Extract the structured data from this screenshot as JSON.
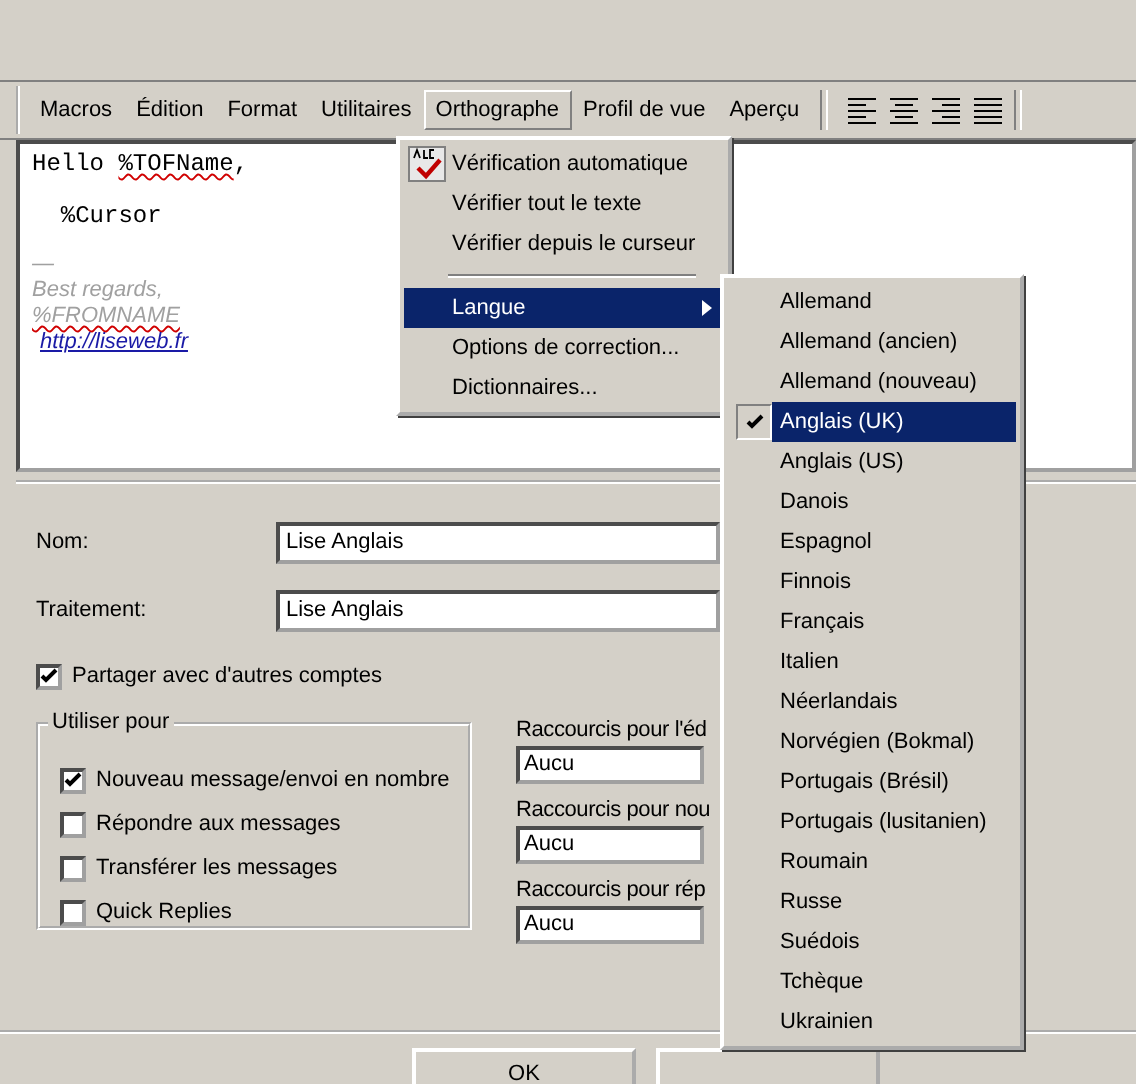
{
  "menubar": {
    "items": [
      {
        "label": "Macros",
        "selected": false
      },
      {
        "label": "Édition",
        "selected": false
      },
      {
        "label": "Format",
        "selected": false
      },
      {
        "label": "Utilitaires",
        "selected": false
      },
      {
        "label": "Orthographe",
        "selected": true
      },
      {
        "label": "Profil de vue",
        "selected": false
      },
      {
        "label": "Aperçu",
        "selected": false
      }
    ]
  },
  "editor": {
    "lines": [
      {
        "kind": "code",
        "segments": [
          {
            "text": "Hello ",
            "misspelled": false
          },
          {
            "text": "%TOFName",
            "misspelled": true
          },
          {
            "text": ",",
            "misspelled": false
          }
        ]
      },
      {
        "kind": "blank"
      },
      {
        "kind": "code",
        "segments": [
          {
            "text": "  %Cursor",
            "misspelled": false
          }
        ]
      },
      {
        "kind": "blank"
      },
      {
        "kind": "signature",
        "segments": [
          {
            "text": "—",
            "misspelled": false
          }
        ]
      },
      {
        "kind": "signature",
        "segments": [
          {
            "text": "Best regards,",
            "misspelled": false
          }
        ]
      },
      {
        "kind": "signature",
        "segments": [
          {
            "text": "%FROMNAME",
            "misspelled": true
          }
        ]
      },
      {
        "kind": "link",
        "segments": [
          {
            "text": "http://liseweb.fr",
            "misspelled": false
          }
        ]
      }
    ]
  },
  "spell_menu": {
    "items": [
      {
        "kind": "toggle",
        "label": "Vérification automatique",
        "checked": true,
        "selected": false
      },
      {
        "kind": "item",
        "label": "Vérifier tout le texte",
        "selected": false
      },
      {
        "kind": "item",
        "label": "Vérifier depuis le curseur",
        "selected": false
      },
      {
        "kind": "separator"
      },
      {
        "kind": "submenu",
        "label": "Langue",
        "selected": true
      },
      {
        "kind": "item",
        "label": "Options de correction...",
        "selected": false
      },
      {
        "kind": "item",
        "label": "Dictionnaires...",
        "selected": false
      }
    ]
  },
  "language_menu": {
    "items": [
      {
        "label": "Allemand",
        "checked": false,
        "selected": false
      },
      {
        "label": "Allemand (ancien)",
        "checked": false,
        "selected": false
      },
      {
        "label": "Allemand (nouveau)",
        "checked": false,
        "selected": false
      },
      {
        "label": "Anglais (UK)",
        "checked": true,
        "selected": true
      },
      {
        "label": "Anglais (US)",
        "checked": false,
        "selected": false
      },
      {
        "label": "Danois",
        "checked": false,
        "selected": false
      },
      {
        "label": "Espagnol",
        "checked": false,
        "selected": false
      },
      {
        "label": "Finnois",
        "checked": false,
        "selected": false
      },
      {
        "label": "Français",
        "checked": false,
        "selected": false
      },
      {
        "label": "Italien",
        "checked": false,
        "selected": false
      },
      {
        "label": "Néerlandais",
        "checked": false,
        "selected": false
      },
      {
        "label": "Norvégien (Bokmal)",
        "checked": false,
        "selected": false
      },
      {
        "label": "Portugais (Brésil)",
        "checked": false,
        "selected": false
      },
      {
        "label": "Portugais (lusitanien)",
        "checked": false,
        "selected": false
      },
      {
        "label": "Roumain",
        "checked": false,
        "selected": false
      },
      {
        "label": "Russe",
        "checked": false,
        "selected": false
      },
      {
        "label": "Suédois",
        "checked": false,
        "selected": false
      },
      {
        "label": "Tchèque",
        "checked": false,
        "selected": false
      },
      {
        "label": "Ukrainien",
        "checked": false,
        "selected": false
      }
    ]
  },
  "form": {
    "fields": [
      {
        "label": "Nom:",
        "value": "Lise Anglais"
      },
      {
        "label": "Traitement:",
        "value": "Lise Anglais"
      }
    ],
    "share": {
      "label": "Partager avec d'autres comptes",
      "checked": true
    },
    "use_for": {
      "title": "Utiliser pour",
      "options": [
        {
          "label": "Nouveau message/envoi en nombre",
          "checked": true
        },
        {
          "label": "Répondre aux messages",
          "checked": false
        },
        {
          "label": "Transférer les messages",
          "checked": false
        },
        {
          "label": "Quick Replies",
          "checked": false
        }
      ]
    },
    "shortcuts": [
      {
        "label": "Raccourcis pour l'éd",
        "value": "Aucu"
      },
      {
        "label": "Raccourcis pour nou",
        "value": "Aucu"
      },
      {
        "label": "Raccourcis pour rép",
        "value": "Aucu"
      }
    ]
  },
  "buttons": [
    {
      "label": "OK"
    }
  ]
}
